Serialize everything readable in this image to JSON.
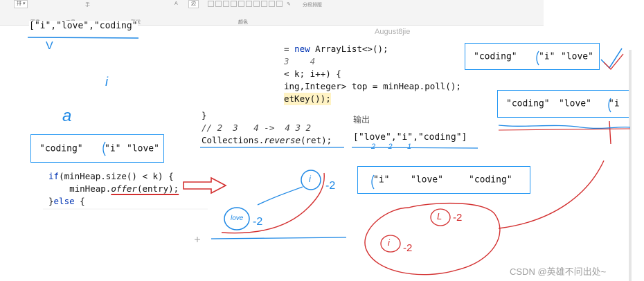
{
  "toolbar": {
    "top_item_1": "排",
    "top_item_2": "手",
    "top_item_3": "A",
    "top_item_4": "边",
    "top_item_5": "分段排版",
    "label_image": "图像",
    "label_tools": "工具",
    "label_shape": "形状",
    "label_color": "颜色"
  },
  "slide1": {
    "array_top": "[\"i\",\"love\",\"coding\"",
    "mark_v": "V",
    "mark_i": "i",
    "mark_alpha": "a",
    "box": {
      "a": "\"coding\"",
      "b": "\"i\"",
      "c": "\"love\""
    },
    "code": {
      "line1_kw": "if",
      "line1_rest": "(minHeap.size() < k) {",
      "line2_pre": "    minHeap.",
      "line2_call": "offer",
      "line2_rest": "(entry);",
      "line3_pre": "}",
      "line3_kw": "else",
      "line3_rest": " {"
    }
  },
  "slide2": {
    "line1_pre": "= ",
    "line1_kw": "new",
    "line1_rest": " ArrayList<>();",
    "line2": "3    4",
    "line3_pre": "< k; i++) {",
    "line4": "ing,Integer> top = minHeap.poll();",
    "line5": "etKey());",
    "brace": "}",
    "comment": "// 2  3   4 ->  4 3 2",
    "reverse_pre": "Collections.",
    "reverse_call": "reverse",
    "reverse_rest": "(ret);",
    "watermark_user": "August8jie"
  },
  "output": {
    "label": "输出",
    "array": "[\"love\",\"i\",\"coding\"]",
    "nums": "2      2       1",
    "box": {
      "a": "\"i\"",
      "b": "\"love\"",
      "c": "\"coding\""
    }
  },
  "annotations": {
    "bubble_love": "love",
    "love_count": "-2",
    "bubble_i": "i",
    "i_count": "-2",
    "red_circle_1": "L",
    "red_count_1": "-2",
    "red_circle_2": "i",
    "red_count_2": "-2"
  },
  "right_boxes": {
    "top": {
      "a": "\"coding\"",
      "b": "\"i\"",
      "c": "\"love\""
    },
    "second": {
      "a": "\"coding\"",
      "b": "\"love\"",
      "c": "\"i"
    }
  },
  "watermark": "CSDN @英雄不问出处~",
  "colors": {
    "box_border": "#2196f3",
    "ink_blue": "#1e88e5",
    "ink_red": "#d32f2f",
    "keyword": "#0033b3"
  }
}
